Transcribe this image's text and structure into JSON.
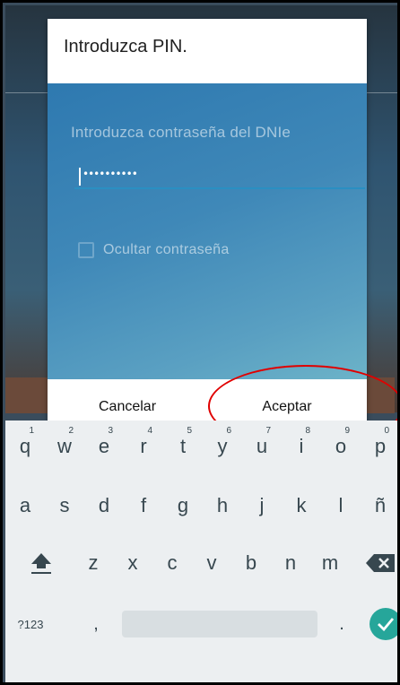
{
  "dialog": {
    "title": "Introduzca PIN.",
    "field_label": "Introduzca contraseña del DNIe",
    "password_mask": "••••••••••",
    "hide_password_label": "Ocultar contraseña",
    "hide_password_checked": false,
    "cancel_label": "Cancelar",
    "accept_label": "Aceptar"
  },
  "keyboard": {
    "row1": [
      {
        "key": "q",
        "hint": "1"
      },
      {
        "key": "w",
        "hint": "2"
      },
      {
        "key": "e",
        "hint": "3"
      },
      {
        "key": "r",
        "hint": "4"
      },
      {
        "key": "t",
        "hint": "5"
      },
      {
        "key": "y",
        "hint": "6"
      },
      {
        "key": "u",
        "hint": "7"
      },
      {
        "key": "i",
        "hint": "8"
      },
      {
        "key": "o",
        "hint": "9"
      },
      {
        "key": "p",
        "hint": "0"
      }
    ],
    "row2": [
      "a",
      "s",
      "d",
      "f",
      "g",
      "h",
      "j",
      "k",
      "l",
      "ñ"
    ],
    "row3": [
      "z",
      "x",
      "c",
      "v",
      "b",
      "n",
      "m"
    ],
    "symbols_label": "?123",
    "comma": ",",
    "period": ".",
    "shift_icon": "shift-arrow",
    "backspace_icon": "backspace",
    "enter_icon": "checkmark"
  },
  "colors": {
    "accent": "#26a69a",
    "highlight_ring": "#e00000",
    "dialog_body": "#3f88b8"
  }
}
